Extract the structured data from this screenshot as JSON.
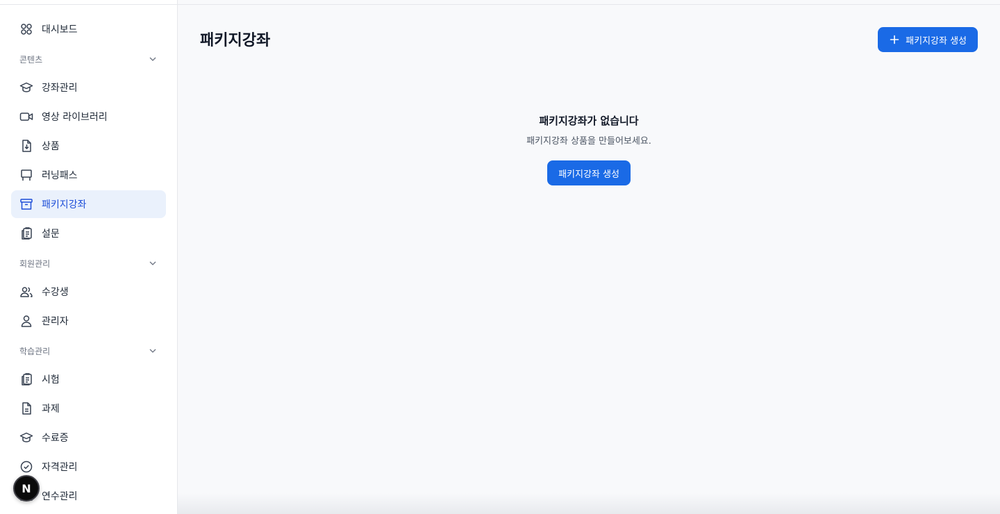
{
  "sidebar": {
    "dashboard": {
      "label": "대시보드",
      "icon": "dashboard-grid-icon"
    },
    "sections": [
      {
        "title": "콘텐츠",
        "items": [
          {
            "label": "강좌관리",
            "icon": "graduation-cap-icon"
          },
          {
            "label": "영상 라이브러리",
            "icon": "video-camera-icon"
          },
          {
            "label": "상품",
            "icon": "file-download-icon"
          },
          {
            "label": "러닝패스",
            "icon": "presentation-board-icon"
          },
          {
            "label": "패키지강좌",
            "icon": "archive-box-icon",
            "active": true
          },
          {
            "label": "설문",
            "icon": "clipboard-copy-icon"
          }
        ]
      },
      {
        "title": "회원관리",
        "items": [
          {
            "label": "수강생",
            "icon": "users-icon"
          },
          {
            "label": "관리자",
            "icon": "user-icon"
          }
        ]
      },
      {
        "title": "학습관리",
        "items": [
          {
            "label": "시험",
            "icon": "clipboard-copy-icon"
          },
          {
            "label": "과제",
            "icon": "document-icon"
          },
          {
            "label": "수료증",
            "icon": "graduation-cap-icon"
          },
          {
            "label": "자격관리",
            "icon": "check-circle-icon"
          },
          {
            "label": "연수관리",
            "icon": "folder-icon"
          }
        ]
      }
    ],
    "avatar_letter": "N"
  },
  "main": {
    "title": "패키지강좌",
    "create_button": "패키지강좌 생성",
    "empty_state": {
      "title": "패키지강좌가 없습니다",
      "description": "패키지강좌 상품을 만들어보세요.",
      "button": "패키지강좌 생성"
    }
  },
  "colors": {
    "accent": "#1a6ae6",
    "active_bg": "#eaf1fc",
    "main_bg": "#f8f9fb"
  }
}
